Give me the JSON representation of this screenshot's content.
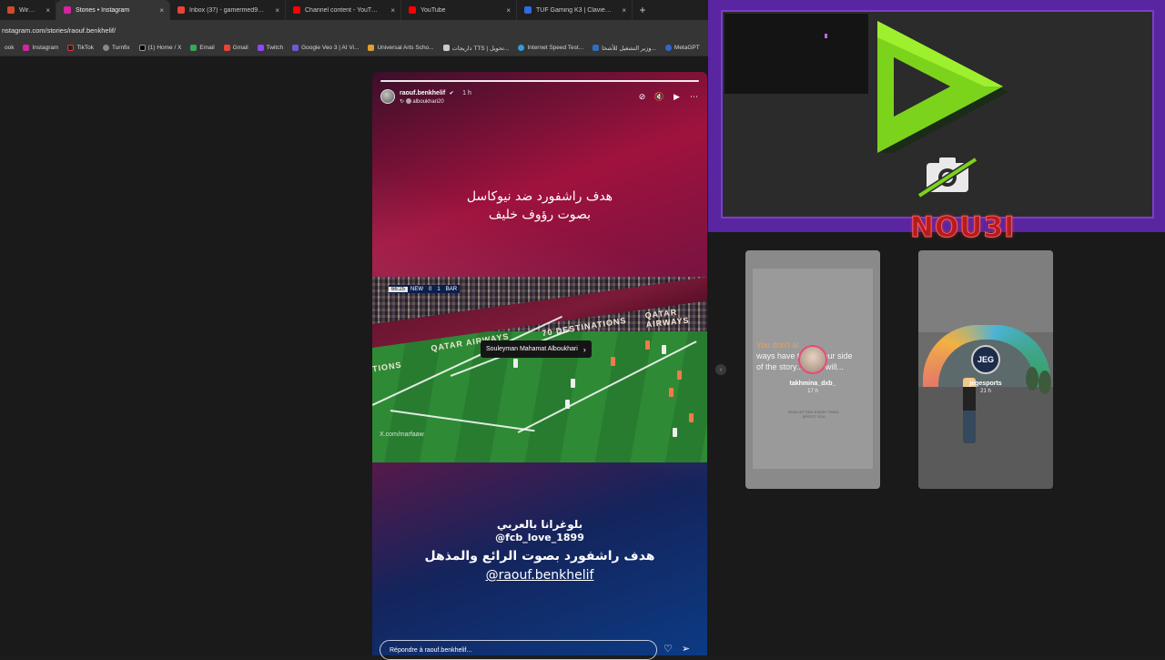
{
  "tabs": [
    {
      "label": "Wired USB Lo",
      "color": "#d24a2b"
    },
    {
      "label": "Stories • Instagram",
      "color": "#d6249f",
      "active": true
    },
    {
      "label": "Inbox (37) - gamermed97@gm",
      "color": "#ea4335"
    },
    {
      "label": "Channel content - YouTube Stu",
      "color": "#ff0000"
    },
    {
      "label": "YouTube",
      "color": "#ff0000"
    },
    {
      "label": "TUF Gaming K3 | Claviers | ASU",
      "color": "#2c6be0"
    }
  ],
  "tab_close_glyph": "×",
  "new_tab_glyph": "+",
  "address": "nstagram.com/stories/raouf.benkhelif/",
  "bookmarks": [
    {
      "label": "ook",
      "color": "#1877f2"
    },
    {
      "label": "Instagram",
      "color": "#d6249f"
    },
    {
      "label": "TikTok",
      "color": "#222222"
    },
    {
      "label": "Turnfix",
      "color": "#888888"
    },
    {
      "label": "(1) Home / X",
      "color": "#000000"
    },
    {
      "label": "Email",
      "color": "#3aa757"
    },
    {
      "label": "Gmail",
      "color": "#ea4335"
    },
    {
      "label": "Twitch",
      "color": "#9146ff"
    },
    {
      "label": "Google Veo 3 | AI Vi...",
      "color": "#6b5bd6"
    },
    {
      "label": "Universal Arts Scho...",
      "color": "#e0a030"
    },
    {
      "label": "داريجات TTS | تحويل...",
      "color": "#cccccc"
    },
    {
      "label": "Internet Speed Test...",
      "color": "#2f9be0"
    },
    {
      "label": "وزير التشغيل للأشخا...",
      "color": "#2d6fbf"
    },
    {
      "label": "MetaGPT",
      "color": "#3366cc"
    }
  ],
  "story": {
    "username": "raouf.benkhelif",
    "verified_glyph": "✔",
    "time": "1 h",
    "repost_user": "alboukhari20",
    "repost_glyph": "↻",
    "header_icons": [
      "⊘",
      "🔇",
      "▶",
      "⋯"
    ],
    "text_top_line1": "هدف راشفورد ضد نيوكاسل",
    "text_top_line2": "بصوت رؤوف خليف",
    "scoreboard": {
      "time": "66:25",
      "home": "NEW",
      "home_score": "0",
      "away_score": "1",
      "away": "BAR"
    },
    "ad_text_1": "QATAR AIRWAYS",
    "ad_text_2": "QATAR AIRWAYS",
    "ad_text_3": "70 DESTINATIONS",
    "ad_text_4": "TIONS",
    "mention_tag": "Souleyman Mahamat Alboukhari",
    "mention_tag_arrow": "›",
    "video_watermark": "X.com/marfaaw",
    "text_bottom_line1": "بلوغرانا  بالعربي",
    "text_bottom_line2": "@fcb_love_1899",
    "text_bottom_line3": "هدف راشفورد بصوت الرائع والمذهل",
    "text_bottom_line4": "@raouf.benkhelif",
    "reply_placeholder": "Répondre à raouf.benkhelif...",
    "reply_icons": [
      "♡",
      "➢"
    ]
  },
  "next_arrow_glyph": "›",
  "side_stories": [
    {
      "username": "takhmina_dxb_",
      "time": "17 h",
      "preview_text_highlight": "You don't al",
      "preview_text_rest": "ways have to tell your side of the story... Time will...",
      "preview_small": "ROM LETTING EVERY THING AFFECT YOU"
    },
    {
      "username": "jegesports",
      "time": "21 h",
      "avatar_text": "JEG"
    }
  ],
  "overlay_brand": "NOU3I",
  "colors": {
    "accent_purple": "#5a25a0",
    "logo_green": "#7cd31c",
    "brand_red": "#b21e1e"
  }
}
